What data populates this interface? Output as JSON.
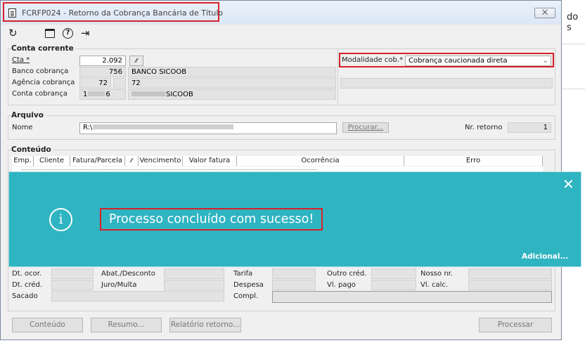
{
  "background": {
    "partial_text": "do s"
  },
  "window": {
    "title": "FCRFP024 - Retorno da Cobrança Bancária de Título",
    "close_glyph": "⨉"
  },
  "toolbar": {
    "refresh_icon": "↻",
    "calendar_icon": "calendar",
    "help_icon": "?",
    "exit_icon": "⇥"
  },
  "conta_corrente": {
    "title": "Conta corrente",
    "cta_label": "Cta *",
    "cta_value": "2.092",
    "banco_label": "Banco cobrança",
    "banco_code": "756",
    "banco_name": "BANCO SICOOB",
    "agencia_label": "Agência cobrança",
    "agencia_code": "72",
    "agencia_name": "72",
    "conta_label": "Conta cobrança",
    "conta_code_partial": "1",
    "conta_code_suffix": "6",
    "conta_name_suffix": "SICOOB",
    "modalidade_label": "Modalidade cob.*",
    "modalidade_value": "Cobrança caucionada direta"
  },
  "arquivo": {
    "title": "Arquivo",
    "nome_label": "Nome",
    "nome_value_prefix": "R:\\",
    "procurar_label": "Procurar...",
    "nr_retorno_label": "Nr. retorno",
    "nr_retorno_value": "1"
  },
  "conteudo": {
    "title": "Conteúdo",
    "columns": [
      "Emp.",
      "Cliente",
      "Fatura/Parcela",
      "",
      "Vencimento",
      "Valor fatura",
      "Ocorrência",
      "Erro"
    ]
  },
  "toast": {
    "message": "Processo concluído com sucesso!",
    "info_glyph": "i",
    "close_glyph": "✕",
    "adicional_label": "Adicional..."
  },
  "details": {
    "dt_ocor": "Dt. ocor.",
    "dt_cred": "Dt. créd.",
    "sacado": "Sacado",
    "abat": "Abat./Desconto",
    "juro": "Juro/Multa",
    "tarifa": "Tarifa",
    "despesa": "Despesa",
    "compl": "Compl.",
    "outro": "Outro créd.",
    "vl_pago": "Vl. pago",
    "nosso": "Nosso nr.",
    "vl_calc": "Vl. calc."
  },
  "buttons": {
    "conteudo": "Conteúdo",
    "resumo": "Resumo...",
    "relatorio": "Relatório retorno...",
    "processar": "Processar"
  }
}
